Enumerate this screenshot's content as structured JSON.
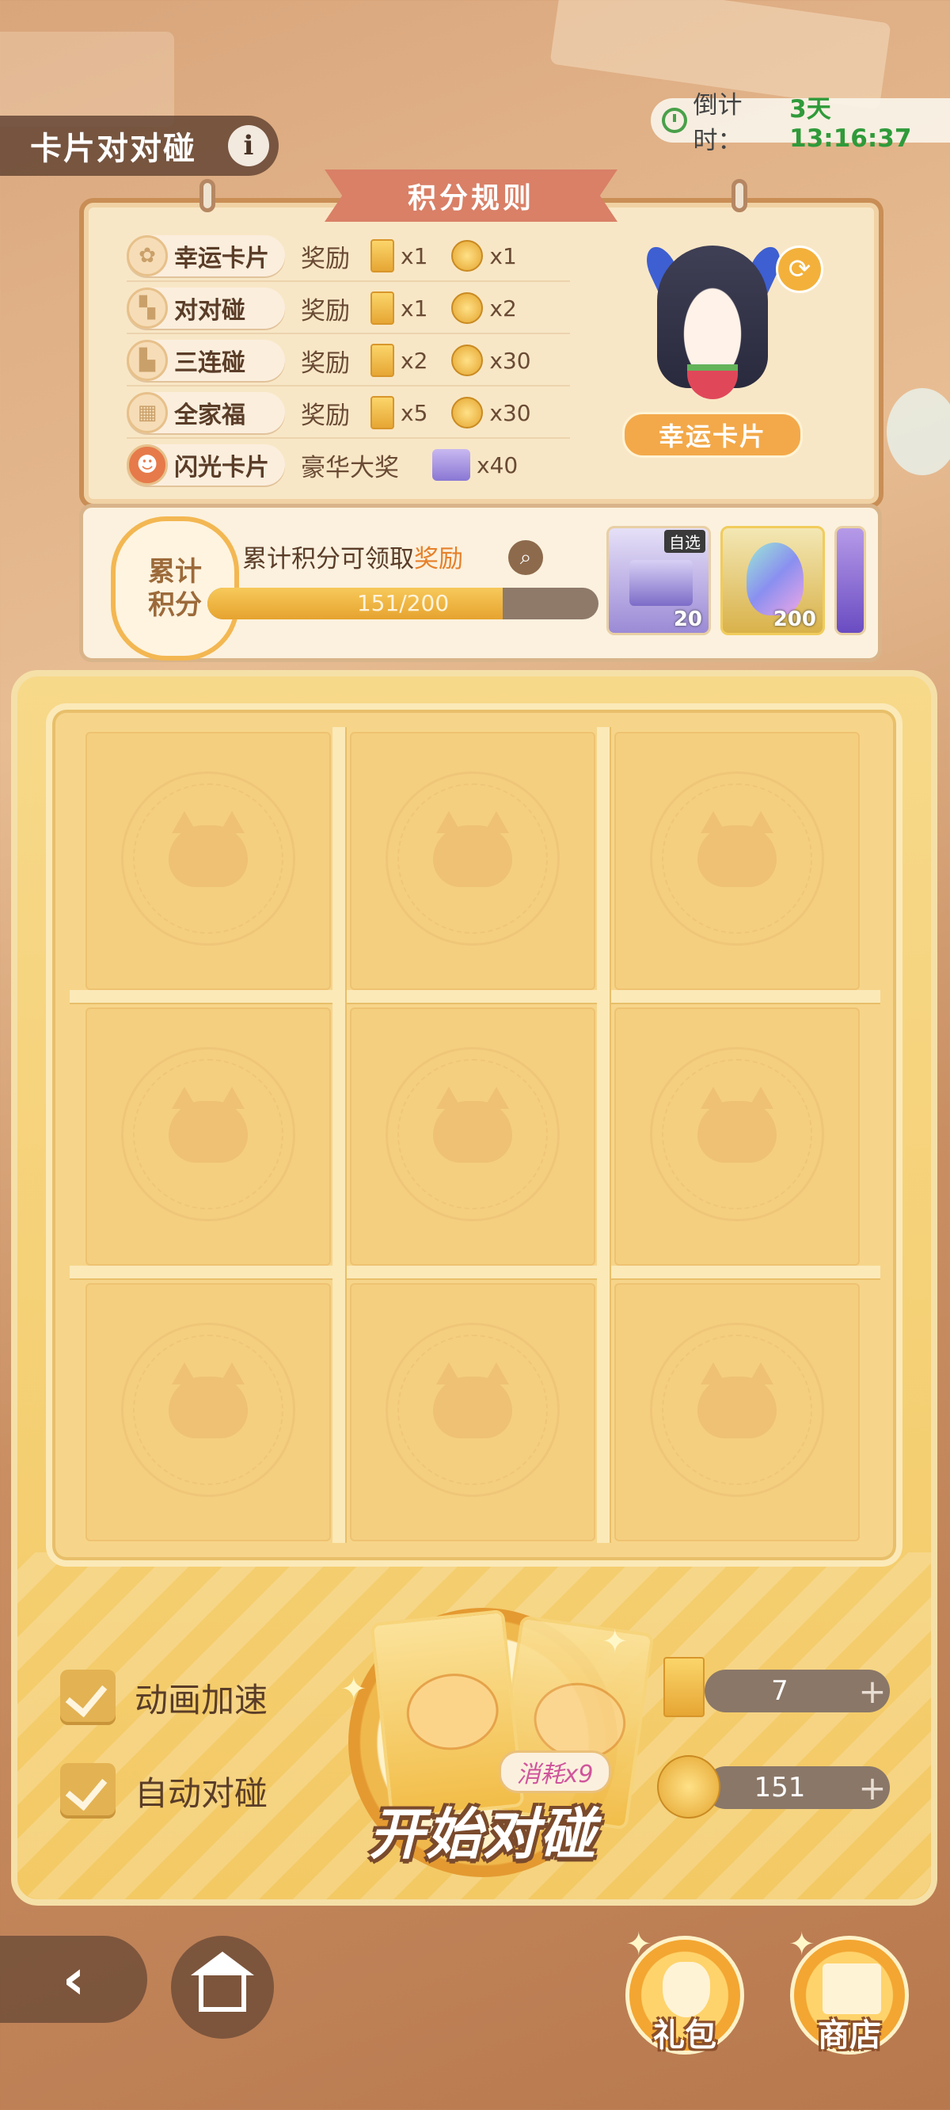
{
  "header": {
    "title": "卡片对对碰",
    "info_icon": "i",
    "countdown_label": "倒计时：",
    "countdown_value": "3天13:16:37"
  },
  "rules": {
    "tab_title": "积分规则",
    "rows": [
      {
        "name": "幸运卡片",
        "reward_word": "奖励",
        "ticket_qty": "x1",
        "coin_qty": "x1",
        "icon": "clover-icon"
      },
      {
        "name": "对对碰",
        "reward_word": "奖励",
        "ticket_qty": "x1",
        "coin_qty": "x2",
        "icon": "pair-icon"
      },
      {
        "name": "三连碰",
        "reward_word": "奖励",
        "ticket_qty": "x2",
        "coin_qty": "x30",
        "icon": "triple-icon"
      },
      {
        "name": "全家福",
        "reward_word": "奖励",
        "ticket_qty": "x5",
        "coin_qty": "x30",
        "icon": "grid-icon"
      },
      {
        "name": "闪光卡片",
        "reward_word": "豪华大奖",
        "chest_qty": "x40",
        "icon": "character-icon"
      }
    ],
    "lucky_card_label": "幸运卡片"
  },
  "points": {
    "badge_line1": "累计",
    "badge_line2": "积分",
    "desc_prefix": "累计积分可领取",
    "desc_highlight": "奖励",
    "progress_text": "151/200",
    "progress_fraction": 0.755,
    "rewards": [
      {
        "tag": "自选",
        "count": "20",
        "icon": "chest-icon"
      },
      {
        "count": "200",
        "icon": "crystal-icon"
      }
    ]
  },
  "controls": {
    "speedup_label": "动画加速",
    "auto_label": "自动对碰",
    "consume_label": "消耗x9",
    "start_label": "开始对碰",
    "ticket_count": "7",
    "coin_count": "151",
    "plus": "+"
  },
  "footer": {
    "back_icon": "‹",
    "gift_label": "礼包",
    "shop_label": "商店"
  },
  "colors": {
    "accent": "#f3a94a",
    "countdown_green": "#2f9a3a",
    "board_yellow": "#f5cf80"
  }
}
